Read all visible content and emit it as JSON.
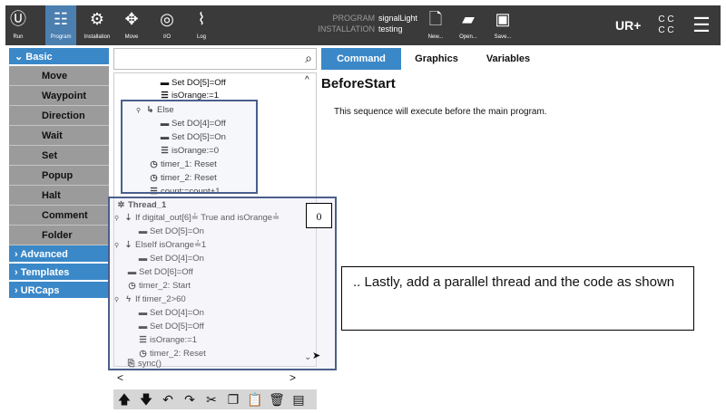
{
  "topbar": {
    "nav": [
      {
        "label": "Run",
        "icon": "ur-logo-icon"
      },
      {
        "label": "Program",
        "icon": "program-icon"
      },
      {
        "label": "Installation",
        "icon": "robot-arm-icon"
      },
      {
        "label": "Move",
        "icon": "move-arrows-icon"
      },
      {
        "label": "I/O",
        "icon": "io-icon"
      },
      {
        "label": "Log",
        "icon": "log-icon"
      }
    ],
    "program_key": "PROGRAM",
    "program_value": "signalLight",
    "installation_key": "INSTALLATION",
    "installation_value": "testing",
    "actions": [
      {
        "label": "New...",
        "icon": "new-file-icon"
      },
      {
        "label": "Open...",
        "icon": "open-folder-icon"
      },
      {
        "label": "Save...",
        "icon": "save-icon"
      }
    ],
    "right_icons": [
      "urplus-icon",
      "cc-icon",
      "hamburger-menu-icon"
    ],
    "cc_text": "C C\nC C",
    "active_color": "#4b7fb0"
  },
  "sidebar": {
    "basic_label": "Basic",
    "items": [
      "Move",
      "Waypoint",
      "Direction",
      "Wait",
      "Set",
      "Popup",
      "Halt",
      "Comment",
      "Folder"
    ],
    "categories": [
      "Advanced",
      "Templates",
      "URCaps"
    ],
    "accent": "#3b88c8"
  },
  "tree": {
    "nodes": [
      {
        "glyph": "▬",
        "text": "Set DO[5]=Off"
      },
      {
        "glyph": "☰",
        "text": "isOrange:=1"
      },
      {
        "glyph": "↳",
        "text": "Else"
      },
      {
        "glyph": "▬",
        "text": "Set DO[4]=Off"
      },
      {
        "glyph": "▬",
        "text": "Set DO[5]=On"
      },
      {
        "glyph": "☰",
        "text": "isOrange:=0"
      },
      {
        "glyph": "◷",
        "text": "timer_1: Reset"
      },
      {
        "glyph": "◷",
        "text": "timer_2: Reset"
      },
      {
        "glyph": "☰",
        "text": "count:=count+1"
      },
      {
        "glyph": "✲",
        "text": "Thread_1"
      },
      {
        "glyph": "⇣",
        "text": "If digital_out[6]≟ True  and isOrange≟"
      },
      {
        "glyph": "▬",
        "text": "Set DO[5]=On"
      },
      {
        "glyph": "⇣",
        "text": "ElseIf isOrange≟1"
      },
      {
        "glyph": "▬",
        "text": "Set DO[4]=On"
      },
      {
        "glyph": "▬",
        "text": "Set DO[6]=Off"
      },
      {
        "glyph": "◷",
        "text": "timer_2: Start"
      },
      {
        "glyph": "ϟ",
        "text": "If timer_2>60"
      },
      {
        "glyph": "▬",
        "text": "Set DO[4]=On"
      },
      {
        "glyph": "▬",
        "text": "Set DO[5]=Off"
      },
      {
        "glyph": "☰",
        "text": "isOrange:=1"
      },
      {
        "glyph": "◷",
        "text": "timer_2: Reset"
      },
      {
        "glyph": "⎘",
        "text": "sync()"
      }
    ],
    "badge": "0",
    "nav_left": "<",
    "nav_right": ">",
    "scroll_up": "^",
    "scroll_down": "⌄"
  },
  "toolbar": {
    "icons": [
      "move-up-icon",
      "move-down-icon",
      "undo-icon",
      "redo-icon",
      "cut-icon",
      "copy-icon",
      "paste-icon",
      "delete-icon",
      "suppress-icon"
    ]
  },
  "tabs": [
    "Command",
    "Graphics",
    "Variables"
  ],
  "content": {
    "title": "BeforeStart",
    "description": "This sequence will execute before the main program."
  },
  "callout": ".. Lastly, add a parallel thread and the code as shown"
}
